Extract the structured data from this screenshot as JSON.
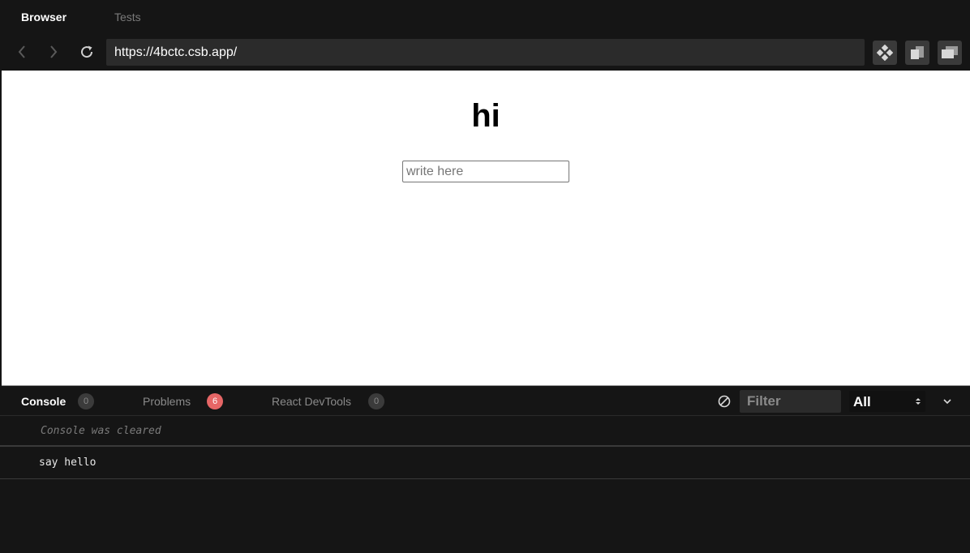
{
  "top_tabs": {
    "browser": "Browser",
    "tests": "Tests"
  },
  "navbar": {
    "url": "https://4bctc.csb.app/",
    "icons": [
      "back-icon",
      "forward-icon",
      "refresh-icon",
      "project-view-icon",
      "open-new-window-icon",
      "open-in-new-tab-icon"
    ]
  },
  "preview": {
    "heading": "hi",
    "input_placeholder": "write here",
    "input_value": ""
  },
  "devtools": {
    "tabs": [
      {
        "label": "Console",
        "count": "0"
      },
      {
        "label": "Problems",
        "count": "6"
      },
      {
        "label": "React DevTools",
        "count": "0"
      }
    ],
    "filter_placeholder": "Filter",
    "level_selected": "All",
    "colors": {
      "problems_badge": "#e66666",
      "count_badge": "#3b3b3b"
    }
  },
  "console": {
    "cleared_message": "Console was cleared",
    "logs": [
      "say hello"
    ]
  }
}
